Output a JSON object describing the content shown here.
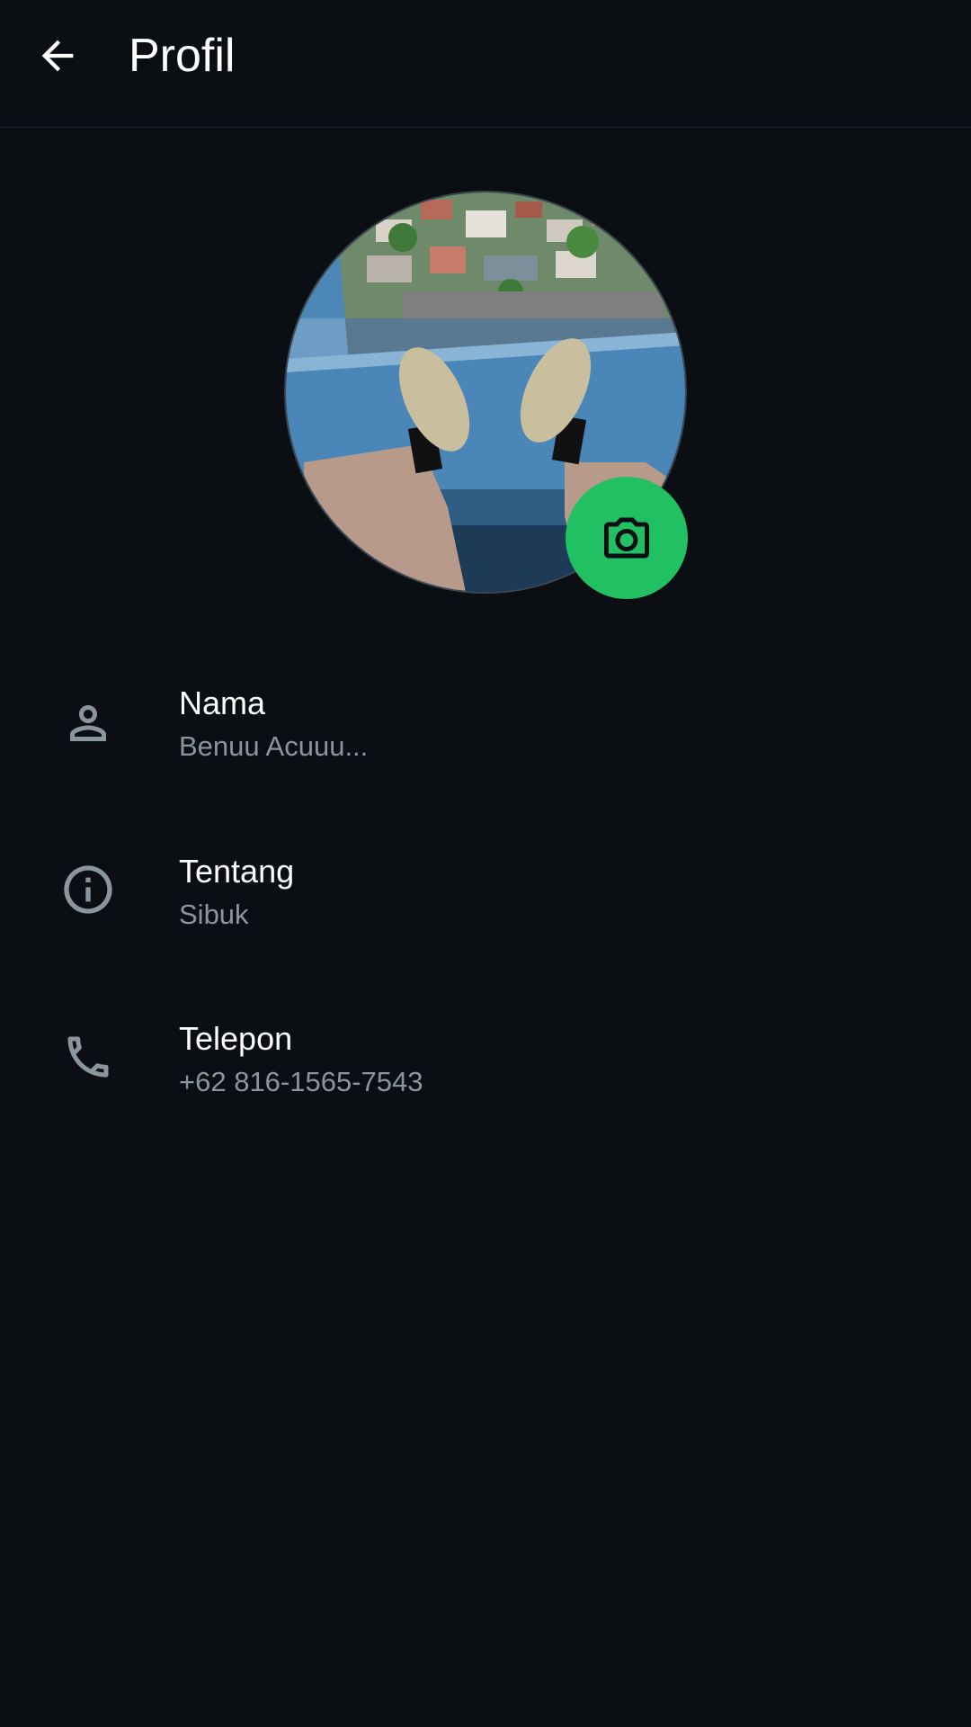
{
  "header": {
    "title": "Profil",
    "back_icon": "arrow-left-icon"
  },
  "avatar": {
    "description_icon": "profile-photo",
    "camera_icon": "camera-icon",
    "camera_color": "#21c063"
  },
  "rows": [
    {
      "icon": "person-icon",
      "label": "Nama",
      "value": "Benuu Acuuu..."
    },
    {
      "icon": "info-icon",
      "label": "Tentang",
      "value": "Sibuk"
    },
    {
      "icon": "phone-icon",
      "label": "Telepon",
      "value": "+62 816-1565-7543"
    }
  ],
  "colors": {
    "background": "#0b0f14",
    "accent": "#21c063",
    "secondary_text": "#8b959e"
  }
}
